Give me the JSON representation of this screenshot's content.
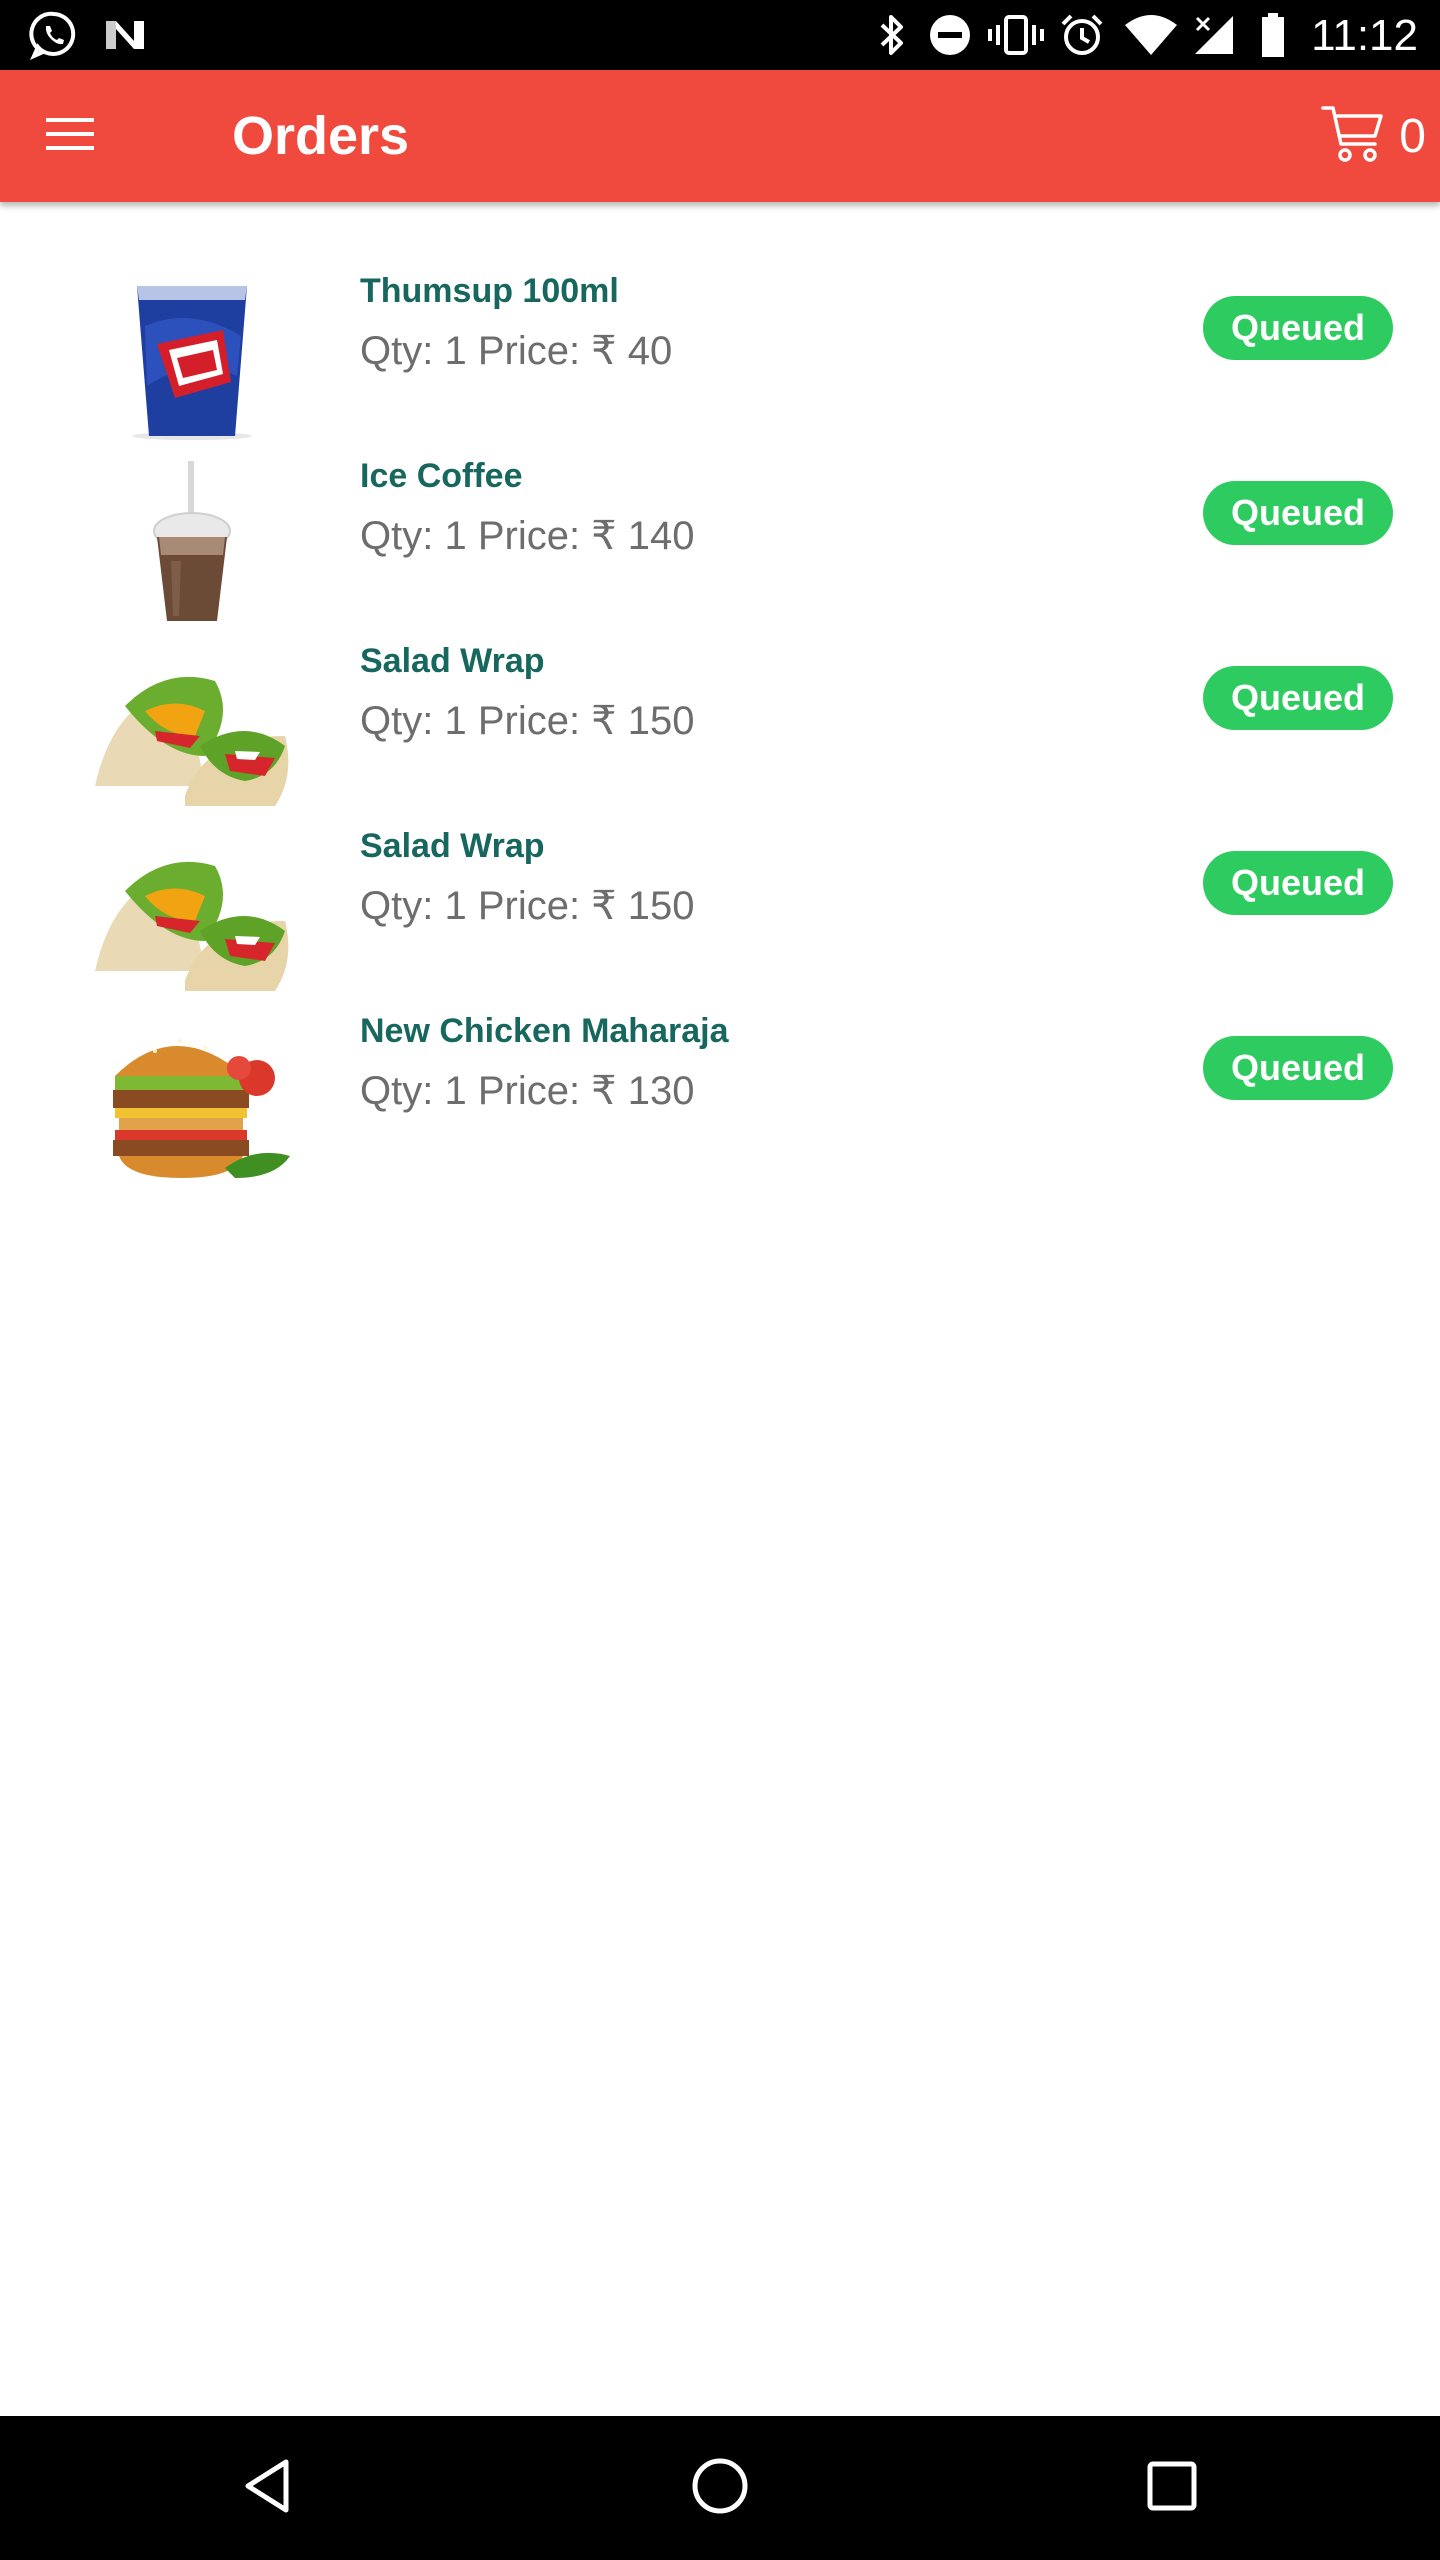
{
  "status_bar": {
    "time": "11:12",
    "left_icons": [
      "whatsapp-icon",
      "notification-n-icon"
    ],
    "right_icons": [
      "bluetooth-icon",
      "do-not-disturb-icon",
      "vibrate-icon",
      "alarm-icon",
      "wifi-icon",
      "cell-signal-off-icon",
      "battery-icon"
    ]
  },
  "app_bar": {
    "title": "Orders",
    "cart_count": "0",
    "color": "#f04a3f"
  },
  "orders": [
    {
      "name": "Thumsup 100ml",
      "detail": "Qty: 1 Price: ₹ 40",
      "status": "Queued",
      "image": "thumsup-cup-image"
    },
    {
      "name": "Ice Coffee",
      "detail": "Qty: 1 Price: ₹ 140",
      "status": "Queued",
      "image": "ice-coffee-image"
    },
    {
      "name": "Salad Wrap",
      "detail": "Qty: 1 Price: ₹ 150",
      "status": "Queued",
      "image": "salad-wrap-image"
    },
    {
      "name": "Salad Wrap",
      "detail": "Qty: 1 Price: ₹ 150",
      "status": "Queued",
      "image": "salad-wrap-image"
    },
    {
      "name": "New Chicken Maharaja",
      "detail": "Qty: 1 Price: ₹ 130",
      "status": "Queued",
      "image": "chicken-burger-image"
    }
  ],
  "colors": {
    "item_name": "#17675e",
    "detail": "#6d6d6d",
    "status_badge": "#2ecc60"
  },
  "nav_bar": {
    "buttons": [
      "back-icon",
      "home-icon",
      "recents-icon"
    ]
  }
}
